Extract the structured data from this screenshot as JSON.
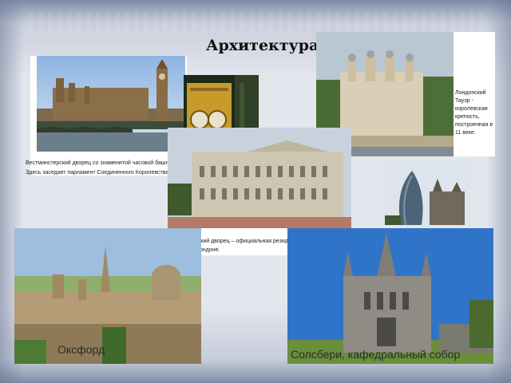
{
  "title": "Архитектура",
  "westminster": {
    "caption_line1": "Вестминстерский дворец со знаменитой часовой башней «Биг Бен».",
    "caption_line2": "Здесь заседает парламент Соединенного Королевства."
  },
  "tower": {
    "caption_lines": [
      "Лондонский",
      "Тауэр -",
      "королевская",
      "крепость,",
      "построенная в",
      "11 веке."
    ]
  },
  "buckingham": {
    "caption_line1": "Букингемский дворец – официальная резиденция королевской",
    "caption_line2": "семьи в Лондоне."
  },
  "oxford": {
    "label": "Оксфорд"
  },
  "salisbury": {
    "label": "Солсбери, кафедральный собор"
  }
}
